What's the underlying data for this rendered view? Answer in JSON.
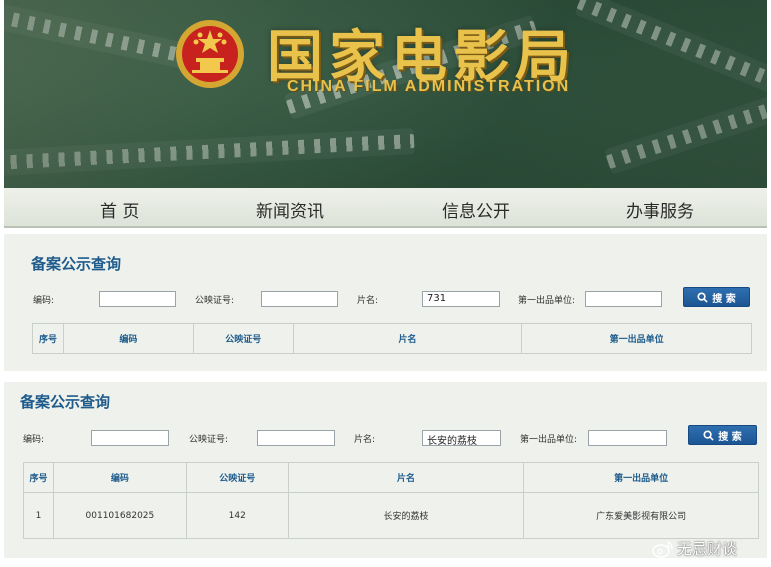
{
  "header": {
    "title_cn": "国家电影局",
    "title_en": "CHINA FILM ADMINISTRATION",
    "emblem_icon": "national-emblem-icon"
  },
  "nav": {
    "items": [
      {
        "label": "首 页"
      },
      {
        "label": "新闻资讯"
      },
      {
        "label": "信息公开"
      },
      {
        "label": "办事服务"
      }
    ]
  },
  "query1": {
    "title": "备案公示查询",
    "code_label": "编码:",
    "code_value": "",
    "cert_label": "公映证号:",
    "cert_value": "",
    "name_label": "片名:",
    "name_value": "731",
    "unit_label": "第一出品单位:",
    "unit_value": "",
    "search_label": "搜 索",
    "columns": [
      "序号",
      "编码",
      "公映证号",
      "片名",
      "第一出品单位"
    ]
  },
  "query2": {
    "title": "备案公示查询",
    "code_label": "编码:",
    "code_value": "",
    "cert_label": "公映证号:",
    "cert_value": "",
    "name_label": "片名:",
    "name_value": "长安的荔枝",
    "unit_label": "第一出品单位:",
    "unit_value": "",
    "search_label": "搜 索",
    "columns": [
      "序号",
      "编码",
      "公映证号",
      "片名",
      "第一出品单位"
    ],
    "rows": [
      {
        "index": "1",
        "code": "001101682025",
        "cert": "142",
        "name": "长安的荔枝",
        "unit": "广东爱美影视有限公司"
      }
    ]
  },
  "watermark": {
    "text": "无忌财谈",
    "icon": "weibo-icon"
  },
  "colors": {
    "title_blue": "#1f5c8c",
    "button_blue": "#1d5593",
    "banner_green": "#3e6149",
    "logo_gold": "#e8c24a"
  }
}
